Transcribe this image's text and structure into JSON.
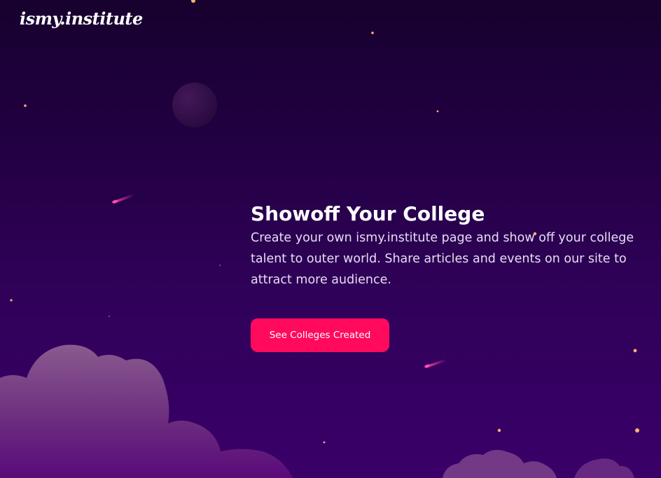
{
  "header": {
    "logo_text": "ismy.institute"
  },
  "hero": {
    "title": "Showoff Your College",
    "description": "Create your own ismy.institute page and show off your college talent to outer world. Share articles and events on our site to attract more audience.",
    "cta_label": "See Colleges Created"
  },
  "colors": {
    "background_top": "#17012e",
    "background_bottom": "#3a0069",
    "cta_background": "#ff0a5c",
    "heading_text": "#ffffff",
    "body_text": "#e9dcf5",
    "star": "#ffb070",
    "cloud": "#7a3e86"
  },
  "icons": [
    "planet-illustration",
    "shooting-star-icon",
    "star-icon",
    "cloud-illustration"
  ]
}
